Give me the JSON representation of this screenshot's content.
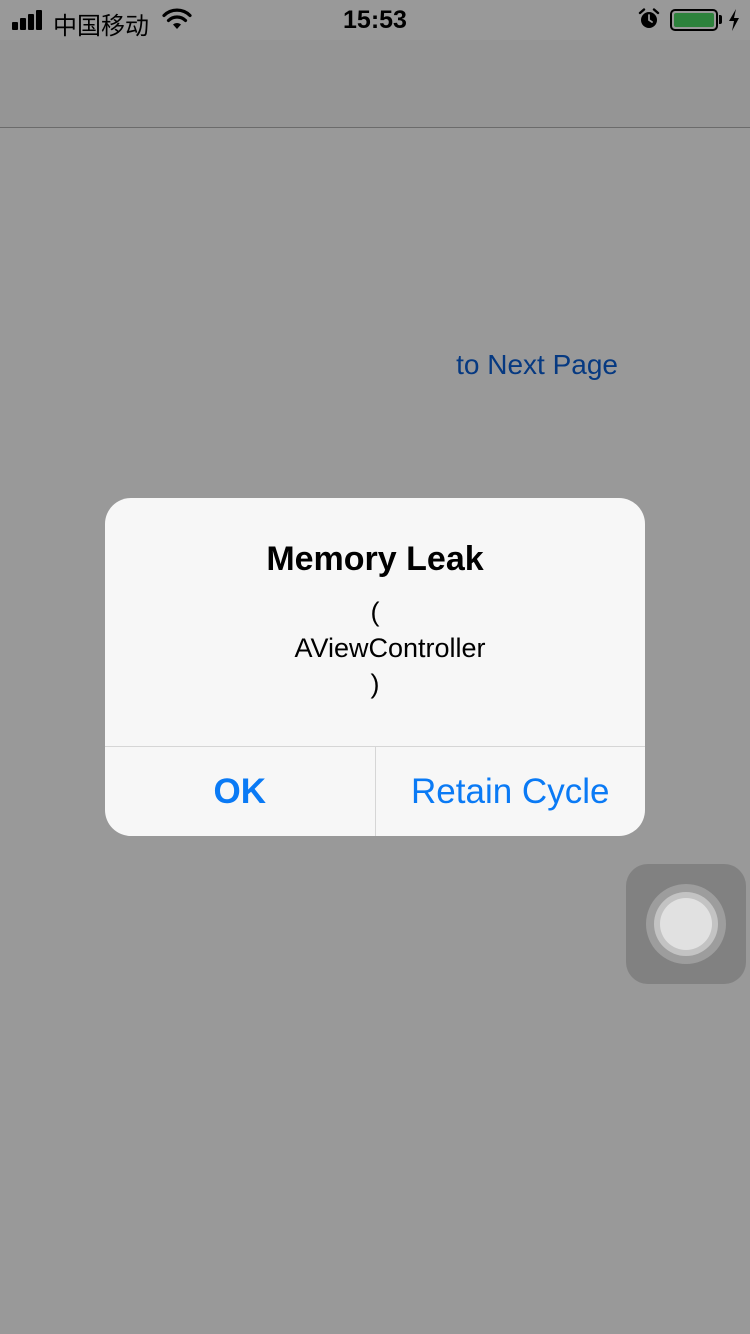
{
  "status_bar": {
    "carrier": "中国移动",
    "time": "15:53",
    "icons": [
      "signal-icon",
      "wifi-icon",
      "alarm-icon",
      "battery-icon",
      "charging-icon"
    ]
  },
  "content": {
    "next_link": "to Next Page"
  },
  "alert": {
    "title": "Memory Leak",
    "message_lines": [
      "(",
      "AViewController",
      ")"
    ],
    "buttons": [
      {
        "label": "OK"
      },
      {
        "label": "Retain Cycle"
      }
    ]
  },
  "colors": {
    "accent": "#0a7af5",
    "link": "#0a60d8",
    "battery": "#4cd964"
  }
}
